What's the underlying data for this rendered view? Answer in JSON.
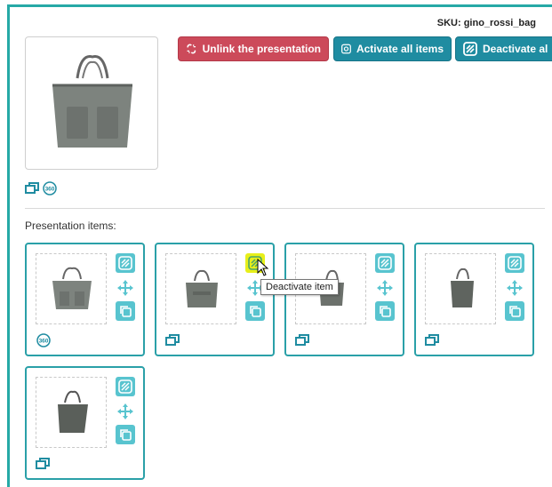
{
  "header": {
    "sku_label": "SKU: gino_rossi_bag"
  },
  "toolbar": {
    "unlink_label": "Unlink the presentation",
    "activate_label": "Activate all items",
    "deactivate_label": "Deactivate al"
  },
  "main_product": {
    "icons": [
      "multi-image-icon",
      "view-360-icon"
    ]
  },
  "presentation": {
    "label": "Presentation items:"
  },
  "items": [
    {
      "foot_icon": "view-360-icon"
    },
    {
      "foot_icon": "multi-image-icon"
    },
    {
      "foot_icon": "multi-image-icon"
    },
    {
      "foot_icon": "multi-image-icon"
    },
    {
      "foot_icon": "multi-image-icon"
    }
  ],
  "tooltip": {
    "text": "Deactivate item"
  },
  "colors": {
    "accent": "#26a9a6",
    "button_red": "#cc4a5a",
    "button_teal": "#1f8ca1",
    "control": "#58c4cf",
    "highlight": "#e7ef1a"
  }
}
